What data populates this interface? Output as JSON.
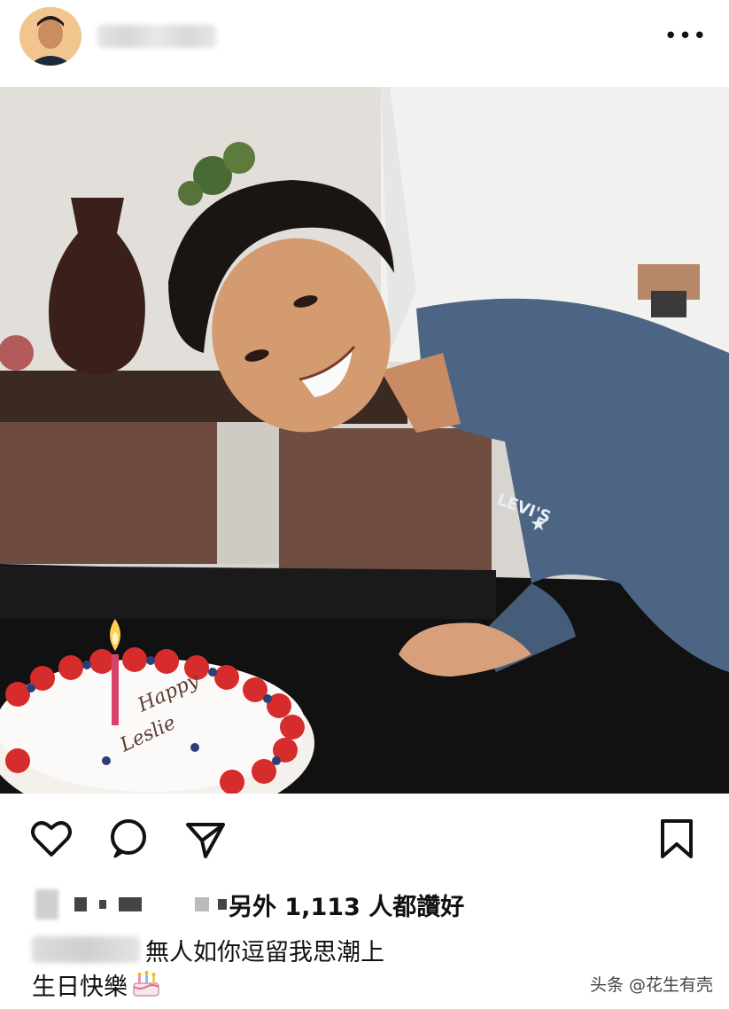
{
  "post": {
    "more_icon": "more-horizontal-icon",
    "likes_text": "另外 1,113 人都讚好",
    "caption_line1": "無人如你逗留我思潮上",
    "caption_line2": "生日快樂",
    "caption_emoji": "birthday-cake-icon",
    "watermark": "头条 @花生有壳"
  },
  "actions": {
    "like_icon": "heart-icon",
    "comment_icon": "comment-icon",
    "share_icon": "send-icon",
    "save_icon": "bookmark-icon"
  }
}
